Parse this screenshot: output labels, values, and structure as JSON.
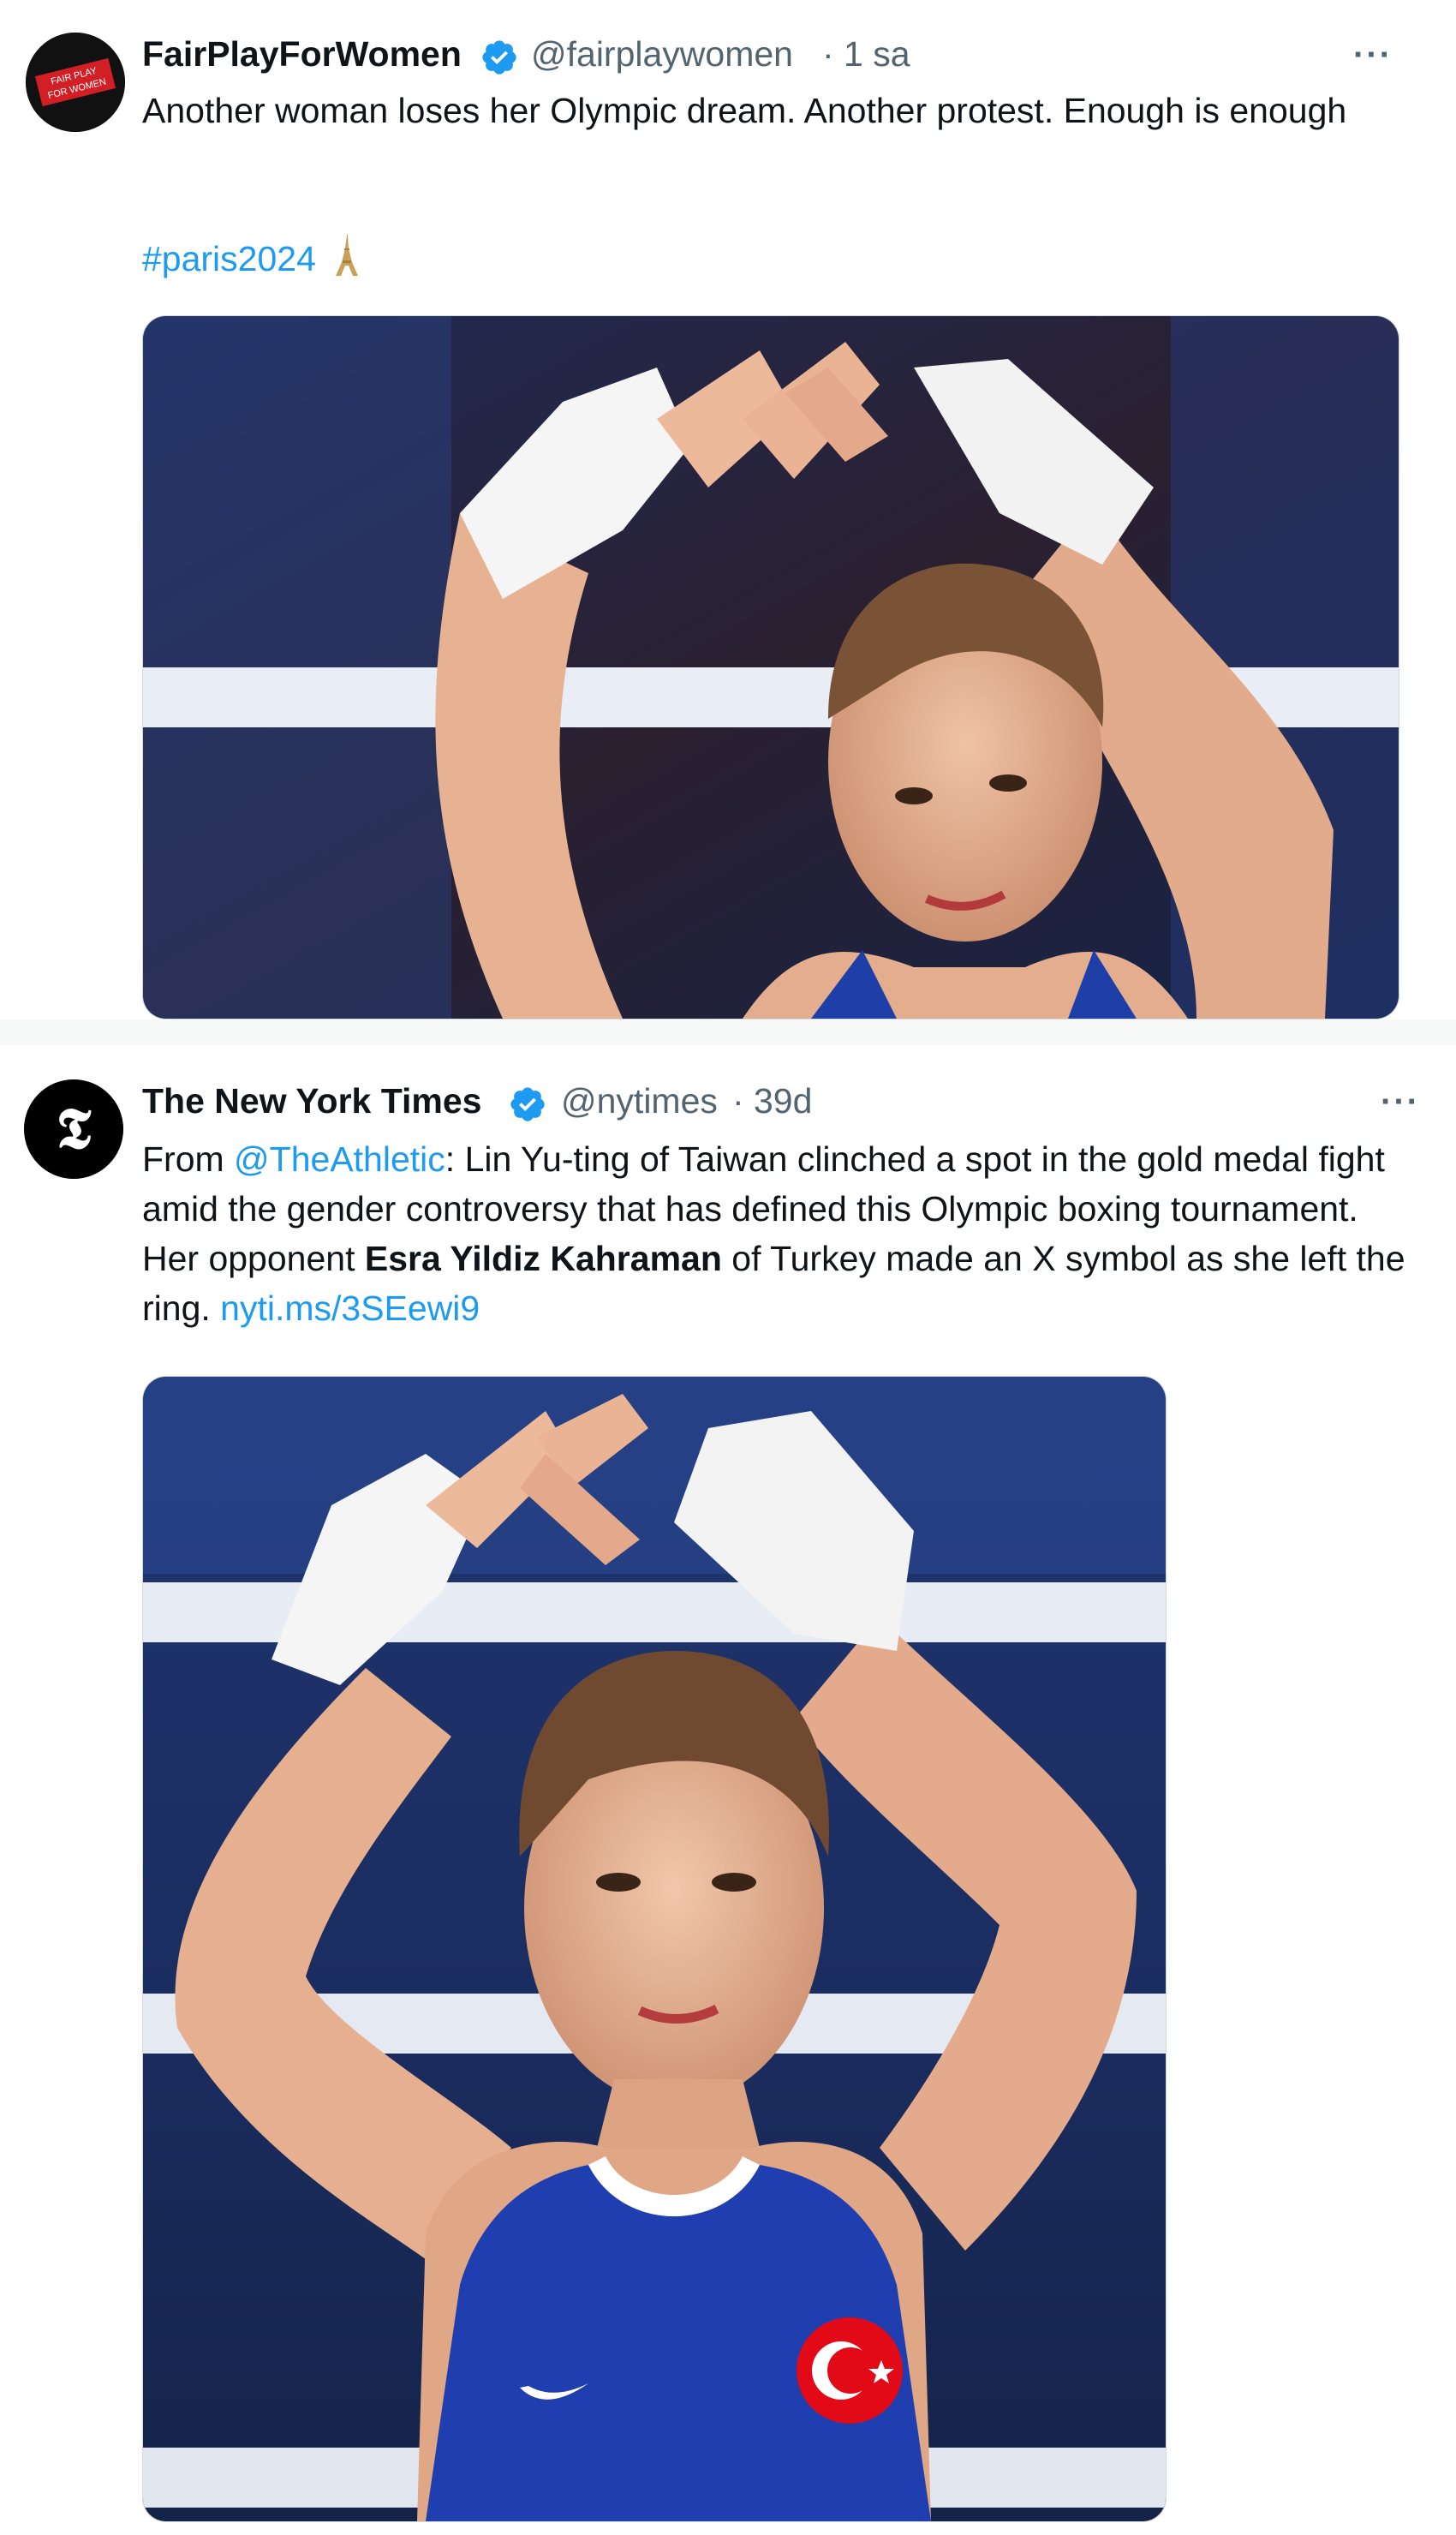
{
  "tweet1": {
    "display_name": "FairPlayForWomen",
    "handle": "@fairplaywomen",
    "separator": "·",
    "time": "1 sa",
    "more_label": "···",
    "text": "Another woman loses her Olympic dream. Another protest. Enough is enough",
    "hashtag": "#paris2024",
    "avatar_text": "FAIR PLAY FOR WOMEN",
    "verified_icon": "verified-badge-icon",
    "colors": {
      "avatar_bg": "#111111",
      "avatar_flag": "#d21f26",
      "link": "#1d9bf0"
    }
  },
  "tweet2": {
    "display_name": "The New York Times",
    "handle": "@nytimes",
    "separator": "·",
    "time": "39d",
    "more_label": "···",
    "text_prefix": "From ",
    "mention": "@TheAthletic",
    "text_part1": ": Lin Yu-ting of Taiwan clinched a spot in the gold medal fight amid the gender controversy that has defined this Olympic boxing tournament. Her opponent ",
    "bold_name": "Esra Yildiz Kahraman",
    "text_part2": " of Turkey made an X symbol as she left the ring. ",
    "url": "nyti.ms/3SEewi9",
    "avatar_glyph": "𝕿",
    "verified_icon": "verified-badge-icon",
    "colors": {
      "avatar_bg": "#000000",
      "link": "#1d9bf0"
    }
  }
}
